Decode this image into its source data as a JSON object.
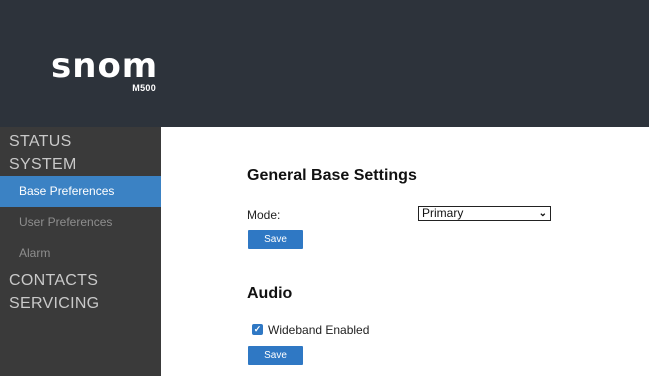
{
  "brand": {
    "logo_text": "snom",
    "model": "M500"
  },
  "sidebar": {
    "sections": [
      {
        "label": "STATUS"
      },
      {
        "label": "SYSTEM",
        "items": [
          {
            "label": "Base Preferences",
            "active": true
          },
          {
            "label": "User Preferences"
          },
          {
            "label": "Alarm"
          }
        ]
      },
      {
        "label": "CONTACTS"
      },
      {
        "label": "SERVICING"
      }
    ]
  },
  "main": {
    "general": {
      "title": "General Base Settings",
      "mode_label": "Mode:",
      "mode_value": "Primary",
      "save_label": "Save"
    },
    "audio": {
      "title": "Audio",
      "wideband_label": "Wideband Enabled",
      "wideband_checked": true,
      "save_label": "Save"
    }
  },
  "colors": {
    "header_bg": "#2d333b",
    "sidebar_bg": "#3a3a3a",
    "accent": "#3b82c4",
    "button": "#2f78c4"
  }
}
